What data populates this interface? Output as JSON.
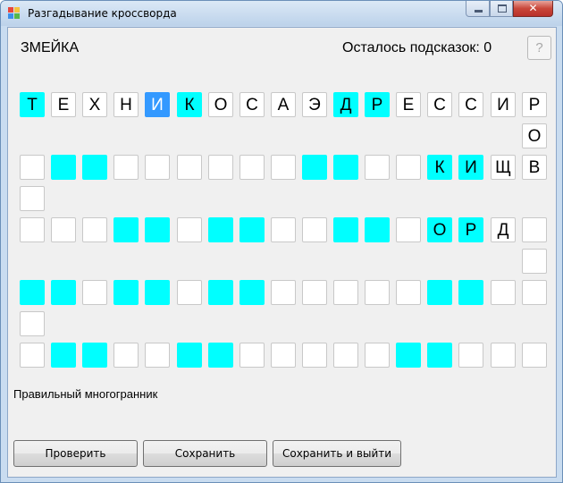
{
  "window": {
    "title": "Разгадывание кроссворда",
    "close_glyph": "✕"
  },
  "header": {
    "puzzle_name": "ЗМЕЙКА",
    "hints_remaining": "Осталось подсказок: 0",
    "hint_button": "?"
  },
  "colors": {
    "highlight": "#00ffff",
    "selected": "#3399ff"
  },
  "grid": {
    "row1": [
      {
        "letter": "Т",
        "hl": "cyan"
      },
      {
        "letter": "Е",
        "hl": ""
      },
      {
        "letter": "Х",
        "hl": ""
      },
      {
        "letter": "Н",
        "hl": ""
      },
      {
        "letter": "И",
        "hl": "sel"
      },
      {
        "letter": "К",
        "hl": "cyan"
      },
      {
        "letter": "О",
        "hl": ""
      },
      {
        "letter": "С",
        "hl": ""
      },
      {
        "letter": "А",
        "hl": ""
      },
      {
        "letter": "Э",
        "hl": ""
      },
      {
        "letter": "Д",
        "hl": "cyan"
      },
      {
        "letter": "Р",
        "hl": "cyan"
      },
      {
        "letter": "Е",
        "hl": ""
      },
      {
        "letter": "С",
        "hl": ""
      },
      {
        "letter": "С",
        "hl": ""
      },
      {
        "letter": "И",
        "hl": ""
      },
      {
        "letter": "Р",
        "hl": ""
      }
    ],
    "row1_extra": [
      {
        "letter": "О",
        "hl": ""
      }
    ],
    "row2": [
      {
        "letter": "",
        "hl": ""
      },
      {
        "letter": "",
        "hl": "cyan"
      },
      {
        "letter": "",
        "hl": "cyan"
      },
      {
        "letter": "",
        "hl": ""
      },
      {
        "letter": "",
        "hl": ""
      },
      {
        "letter": "",
        "hl": ""
      },
      {
        "letter": "",
        "hl": ""
      },
      {
        "letter": "",
        "hl": ""
      },
      {
        "letter": "",
        "hl": ""
      },
      {
        "letter": "",
        "hl": "cyan"
      },
      {
        "letter": "",
        "hl": "cyan"
      },
      {
        "letter": "",
        "hl": ""
      },
      {
        "letter": "",
        "hl": ""
      },
      {
        "letter": "К",
        "hl": "cyan"
      },
      {
        "letter": "И",
        "hl": "cyan"
      },
      {
        "letter": "Щ",
        "hl": ""
      },
      {
        "letter": "В",
        "hl": ""
      }
    ],
    "row2_extra": [
      {
        "letter": "",
        "hl": ""
      }
    ],
    "row3": [
      {
        "letter": "",
        "hl": ""
      },
      {
        "letter": "",
        "hl": ""
      },
      {
        "letter": "",
        "hl": ""
      },
      {
        "letter": "",
        "hl": "cyan"
      },
      {
        "letter": "",
        "hl": "cyan"
      },
      {
        "letter": "",
        "hl": ""
      },
      {
        "letter": "",
        "hl": "cyan"
      },
      {
        "letter": "",
        "hl": "cyan"
      },
      {
        "letter": "",
        "hl": ""
      },
      {
        "letter": "",
        "hl": ""
      },
      {
        "letter": "",
        "hl": "cyan"
      },
      {
        "letter": "",
        "hl": "cyan"
      },
      {
        "letter": "",
        "hl": ""
      },
      {
        "letter": "О",
        "hl": "cyan"
      },
      {
        "letter": "Р",
        "hl": "cyan"
      },
      {
        "letter": "Д",
        "hl": ""
      },
      {
        "letter": "",
        "hl": ""
      }
    ],
    "row3_extra": [
      {
        "letter": "",
        "hl": ""
      }
    ],
    "row4": [
      {
        "letter": "",
        "hl": "cyan"
      },
      {
        "letter": "",
        "hl": "cyan"
      },
      {
        "letter": "",
        "hl": ""
      },
      {
        "letter": "",
        "hl": "cyan"
      },
      {
        "letter": "",
        "hl": "cyan"
      },
      {
        "letter": "",
        "hl": ""
      },
      {
        "letter": "",
        "hl": "cyan"
      },
      {
        "letter": "",
        "hl": "cyan"
      },
      {
        "letter": "",
        "hl": ""
      },
      {
        "letter": "",
        "hl": ""
      },
      {
        "letter": "",
        "hl": ""
      },
      {
        "letter": "",
        "hl": ""
      },
      {
        "letter": "",
        "hl": ""
      },
      {
        "letter": "",
        "hl": "cyan"
      },
      {
        "letter": "",
        "hl": "cyan"
      },
      {
        "letter": "",
        "hl": ""
      },
      {
        "letter": "",
        "hl": ""
      }
    ],
    "row4_extra": [
      {
        "letter": "",
        "hl": ""
      }
    ],
    "row5": [
      {
        "letter": "",
        "hl": ""
      },
      {
        "letter": "",
        "hl": "cyan"
      },
      {
        "letter": "",
        "hl": "cyan"
      },
      {
        "letter": "",
        "hl": ""
      },
      {
        "letter": "",
        "hl": ""
      },
      {
        "letter": "",
        "hl": "cyan"
      },
      {
        "letter": "",
        "hl": "cyan"
      },
      {
        "letter": "",
        "hl": ""
      },
      {
        "letter": "",
        "hl": ""
      },
      {
        "letter": "",
        "hl": ""
      },
      {
        "letter": "",
        "hl": ""
      },
      {
        "letter": "",
        "hl": ""
      },
      {
        "letter": "",
        "hl": "cyan"
      },
      {
        "letter": "",
        "hl": "cyan"
      },
      {
        "letter": "",
        "hl": ""
      },
      {
        "letter": "",
        "hl": ""
      },
      {
        "letter": "",
        "hl": ""
      }
    ]
  },
  "clue": "Правильный многогранник",
  "buttons": {
    "check": "Проверить",
    "save": "Сохранить",
    "save_exit": "Сохранить и выйти"
  }
}
